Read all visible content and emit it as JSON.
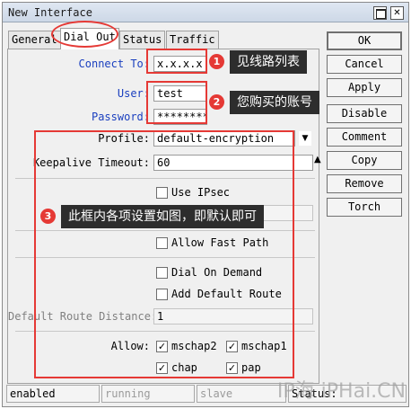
{
  "window": {
    "title": "New Interface",
    "close_glyph": "✕"
  },
  "tabs": [
    {
      "label": "General",
      "active": false
    },
    {
      "label": "Dial Out",
      "active": true
    },
    {
      "label": "Status",
      "active": false
    },
    {
      "label": "Traffic",
      "active": false
    }
  ],
  "form": {
    "connect_to": {
      "label": "Connect To:",
      "value": "x.x.x.x"
    },
    "user": {
      "label": "User:",
      "value": "test"
    },
    "password": {
      "label": "Password:",
      "value": "*********"
    },
    "profile": {
      "label": "Profile:",
      "value": "default-encryption"
    },
    "keepalive": {
      "label": "Keepalive Timeout:",
      "value": "60"
    },
    "use_ipsec": {
      "label": "Use IPsec",
      "checked": false
    },
    "allow_fast_path": {
      "label": "Allow Fast Path",
      "checked": false
    },
    "dial_on_demand": {
      "label": "Dial On Demand",
      "checked": false
    },
    "add_default_route": {
      "label": "Add Default Route",
      "checked": false
    },
    "default_route_distance": {
      "label": "Default Route Distance:",
      "value": "1"
    },
    "allow": {
      "label": "Allow:",
      "mschap2": {
        "label": "mschap2",
        "checked": true
      },
      "mschap1": {
        "label": "mschap1",
        "checked": true
      },
      "chap": {
        "label": "chap",
        "checked": true
      },
      "pap": {
        "label": "pap",
        "checked": true
      }
    }
  },
  "buttons": {
    "ok": "OK",
    "cancel": "Cancel",
    "apply": "Apply",
    "disable": "Disable",
    "comment": "Comment",
    "copy": "Copy",
    "remove": "Remove",
    "torch": "Torch"
  },
  "status": {
    "enabled": "enabled",
    "running": "running",
    "slave": "slave",
    "status": "Status:"
  },
  "annotations": {
    "one": {
      "num": "1",
      "text": "见线路列表"
    },
    "two": {
      "num": "2",
      "text": "您购买的账号"
    },
    "three": {
      "num": "3",
      "text": "此框内各项设置如图，即默认即可"
    }
  },
  "watermark": "IP海 iPHai.CN",
  "colors": {
    "annotation_red": "#e53935",
    "callout_bg": "#2d2d2d",
    "label_blue": "#1a3fbf"
  }
}
